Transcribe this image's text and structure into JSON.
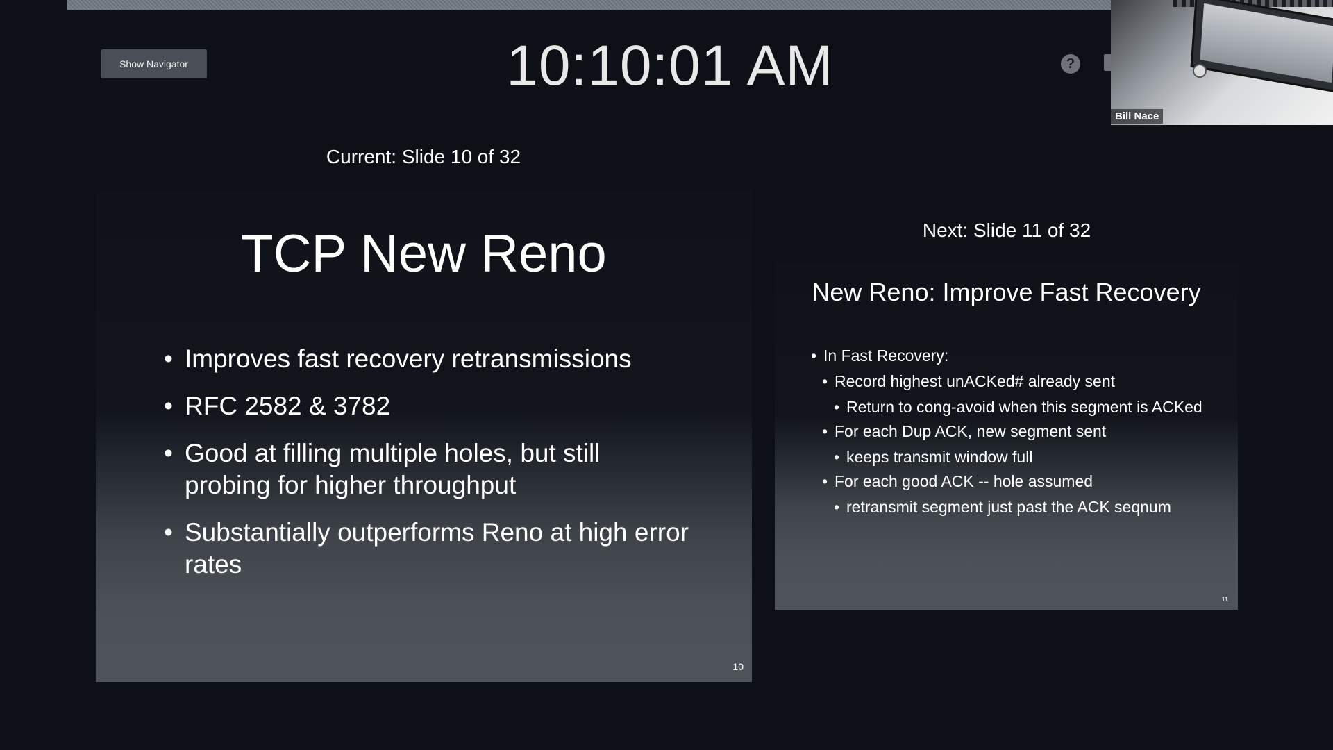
{
  "toolbar": {
    "show_navigator_label": "Show Navigator",
    "clock": "10:10:01 AM",
    "help_icon": "?"
  },
  "video": {
    "participant_name": "Bill Nace"
  },
  "current": {
    "label": "Current: Slide 10 of 32",
    "title": "TCP New Reno",
    "bullets": [
      "Improves fast recovery retransmissions",
      "RFC 2582 & 3782",
      "Good at filling multiple holes, but still probing for higher throughput",
      "Substantially outperforms Reno at high error rates"
    ],
    "page_number": "10"
  },
  "next": {
    "label": "Next: Slide 11 of 32",
    "title": "New Reno: Improve Fast Recovery",
    "bullets": [
      {
        "level": 1,
        "text": "In Fast Recovery:"
      },
      {
        "level": 2,
        "text": "Record highest unACKed# already sent"
      },
      {
        "level": 3,
        "text": "Return to cong-avoid when this segment is ACKed"
      },
      {
        "level": 2,
        "text": "For each Dup ACK, new segment sent"
      },
      {
        "level": 3,
        "text": "keeps transmit window full"
      },
      {
        "level": 2,
        "text": "For each good ACK -- hole assumed"
      },
      {
        "level": 3,
        "text": "retransmit segment just past the ACK seqnum"
      }
    ],
    "page_number": "11"
  },
  "colors": {
    "background": "#0e1018",
    "button": "#4a4e56"
  }
}
